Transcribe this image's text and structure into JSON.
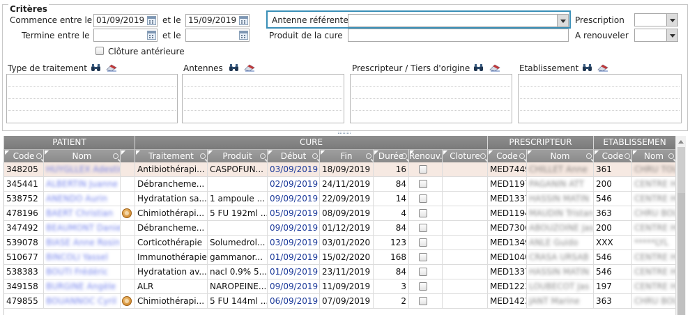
{
  "criteria": {
    "title": "Critères",
    "commence_entre_label": "Commence entre le",
    "commence_from": "01/09/2019",
    "et_le_1": "et le",
    "commence_to": "15/09/2019",
    "termine_entre_label": "Termine entre le",
    "termine_from": "",
    "et_le_2": "et le",
    "termine_to": "",
    "cloture_anterieure_label": "Clôture antérieure",
    "antenne_referente_label": "Antenne référente",
    "antenne_referente_value": "",
    "produit_cure_label": "Produit de la cure",
    "produit_cure_value": "",
    "prescription_label": "Prescription",
    "prescription_value": "",
    "a_renouveler_label": "A renouveler",
    "a_renouveler_value": "",
    "lists": [
      {
        "label": "Type de traitement"
      },
      {
        "label": "Antennes"
      },
      {
        "label": "Prescripteur / Tiers d'origine"
      },
      {
        "label": "Etablissement"
      }
    ],
    "accent": "#3a8fb7"
  },
  "grid": {
    "groups": [
      "PATIENT",
      "CURE",
      "PRESCRIPTEUR",
      "ETABLISSEMEN"
    ],
    "columns": [
      "Code",
      "Nom",
      "",
      "Traitement",
      "Produit",
      "Début",
      "Fin",
      "Durée",
      "Renouv.",
      "Cloture",
      "Code",
      "Nom",
      "Code",
      "Nom"
    ],
    "rows": [
      {
        "code": "348205",
        "nom": "HUYGLLEX Adestir",
        "icon": false,
        "traitement": "Antibiothérapi...",
        "produit": "CASPOFUN...",
        "debut": "03/09/2019",
        "fin": "18/09/2019",
        "duree": "16",
        "cloture": "",
        "p_code": "MED7449",
        "p_nom": "CHILLET Anne",
        "e_code": "361",
        "e_nom": "CHRU TOURS",
        "selected": true
      },
      {
        "code": "345441",
        "nom": "ALBERTIN Juanne",
        "icon": false,
        "traitement": "Débrancheme...",
        "produit": "",
        "debut": "02/09/2019",
        "fin": "24/11/2019",
        "duree": "84",
        "cloture": "",
        "p_code": "MED1197",
        "p_nom": "PAGANIN ATT",
        "e_code": "200",
        "e_nom": "CENTRE HOSP",
        "selected": false
      },
      {
        "code": "538752",
        "nom": "ANENDO Aurin",
        "icon": false,
        "traitement": "Hydratation sa...",
        "produit": "1 ampoule ...",
        "debut": "09/09/2019",
        "fin": "22/09/2019",
        "duree": "14",
        "cloture": "",
        "p_code": "MED1337",
        "p_nom": "HASSIN MATIN",
        "e_code": "546",
        "e_nom": "CENTRE HOS",
        "selected": false
      },
      {
        "code": "478196",
        "nom": "BAERT Christian",
        "icon": true,
        "traitement": "Chimiothérapi...",
        "produit": "5 FU 192ml ...",
        "debut": "05/09/2019",
        "fin": "08/09/2019",
        "duree": "4",
        "cloture": "",
        "p_code": "MED1194",
        "p_nom": "MAUDIN Tristan",
        "e_code": "363",
        "e_nom": "CHRU BOUR",
        "selected": false
      },
      {
        "code": "347492",
        "nom": "BEAUMONT Daniel",
        "icon": false,
        "traitement": "Débrancheme...",
        "produit": "",
        "debut": "09/09/2019",
        "fin": "01/12/2019",
        "duree": "84",
        "cloture": "",
        "p_code": "MED7306",
        "p_nom": "ABOUZOINE Jas",
        "e_code": "200",
        "e_nom": "CENTRE HOS",
        "selected": false
      },
      {
        "code": "539078",
        "nom": "BIASE Anne Rosin",
        "icon": false,
        "traitement": "Corticothérapie",
        "produit": "Solumedrol...",
        "debut": "03/09/2019",
        "fin": "03/01/2020",
        "duree": "123",
        "cloture": "",
        "p_code": "MED1349",
        "p_nom": "ANLE Guido",
        "e_code": "XXX",
        "e_nom": "*****LYL",
        "selected": false
      },
      {
        "code": "510677",
        "nom": "BINCOLI Yassel",
        "icon": false,
        "traitement": "Immunothérapie",
        "produit": "gammanor...",
        "debut": "01/09/2019",
        "fin": "15/02/2020",
        "duree": "168",
        "cloture": "",
        "p_code": "MED1040",
        "p_nom": "CRASA URSAB",
        "e_code": "546",
        "e_nom": "CENTRE HOS",
        "selected": false
      },
      {
        "code": "538383",
        "nom": "BOUTI Frédéric",
        "icon": false,
        "traitement": "Hydratation av...",
        "produit": "nacl 0.9% 5...",
        "debut": "01/09/2019",
        "fin": "23/11/2019",
        "duree": "84",
        "cloture": "",
        "p_code": "MED1337",
        "p_nom": "HASSIN MATIN",
        "e_code": "546",
        "e_nom": "CENTRE HOS",
        "selected": false
      },
      {
        "code": "349158",
        "nom": "BURGINE Angèle",
        "icon": false,
        "traitement": "ALR",
        "produit": "NAROPEINE...",
        "debut": "09/09/2019",
        "fin": "11/09/2019",
        "duree": "3",
        "cloture": "",
        "p_code": "MED1223",
        "p_nom": "LOUBECOT Jas",
        "e_code": "197",
        "e_nom": "CENTRE HOS",
        "selected": false
      },
      {
        "code": "479855",
        "nom": "BOUANNOC Cyril",
        "icon": true,
        "traitement": "Chimiothérapi...",
        "produit": "5 FU 144ml ...",
        "debut": "06/09/2019",
        "fin": "07/09/2019",
        "duree": "2",
        "cloture": "",
        "p_code": "MED1423",
        "p_nom": "JANT Marine",
        "e_code": "363",
        "e_nom": "CHRU BOUR",
        "selected": false
      }
    ]
  },
  "icons": {
    "calendar": "calendar-icon",
    "binoculars": "binoculars-icon",
    "eraser": "eraser-icon",
    "search": "search-icon",
    "warning": "alert-icon"
  }
}
